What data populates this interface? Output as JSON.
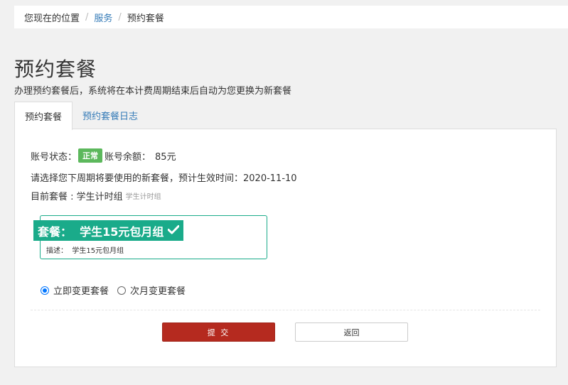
{
  "breadcrumb": {
    "label": "您现在的位置",
    "items": [
      "服务",
      "预约套餐"
    ],
    "separator": "/"
  },
  "page": {
    "title": "预约套餐",
    "subtitle": "办理预约套餐后，系统将在本计费周期结束后自动为您更换为新套餐"
  },
  "tabs": [
    {
      "label": "预约套餐",
      "active": true
    },
    {
      "label": "预约套餐日志",
      "active": false
    }
  ],
  "account": {
    "status_label": "账号状态：",
    "status_badge": "正常",
    "balance_label": "账号余额：",
    "balance_value": "85元",
    "badge_color": "#5cb85c"
  },
  "notice": {
    "text": "请选择您下周期将要使用的新套餐，预计生效时间：2020-11-10"
  },
  "current_package": {
    "label": "目前套餐 : 学生计时组",
    "sub": "学生计时组"
  },
  "package_card": {
    "title": "套餐：  学生15元包月组",
    "check_icon": "checkmark-icon",
    "desc": "描述：  学生15元包月组",
    "accent_color": "#1aab8a"
  },
  "change_options": [
    {
      "label": "立即变更套餐",
      "selected": true
    },
    {
      "label": "次月变更套餐",
      "selected": false
    }
  ],
  "buttons": {
    "submit": "提 交",
    "back": "返回",
    "submit_color": "#b52a1f"
  }
}
